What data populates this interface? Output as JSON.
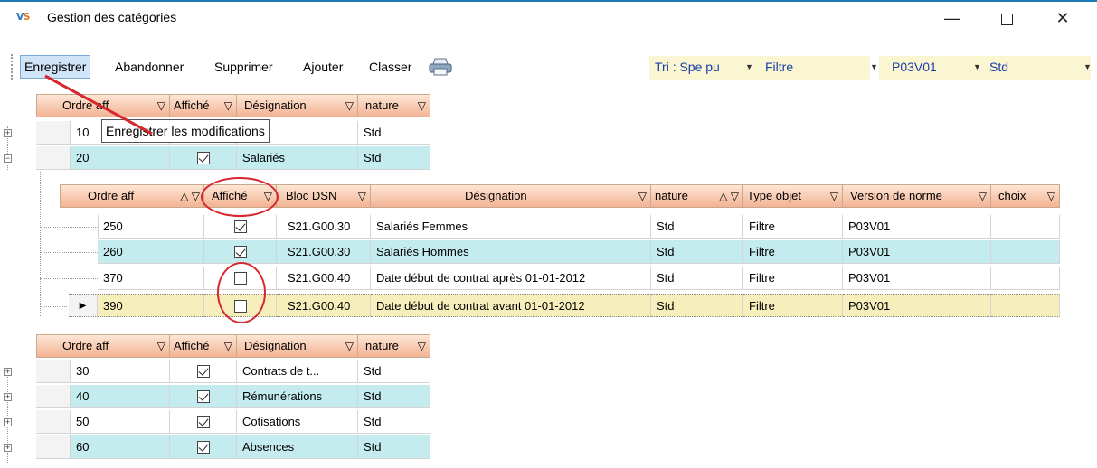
{
  "window": {
    "title": "Gestion des catégories",
    "logo": "VS",
    "min_label": "—",
    "close_label": "✕"
  },
  "toolbar": {
    "buttons": [
      "Enregistrer",
      "Abandonner",
      "Supprimer",
      "Ajouter",
      "Classer"
    ],
    "sort_value": "Tri : Spe pu",
    "filter_value": "Filtre",
    "version_value": "P03V01",
    "std_value": "Std"
  },
  "tooltip": "Enregistrer les modifications",
  "outer_headers": [
    "Ordre aff",
    "Affiché",
    "Désignation",
    "nature"
  ],
  "top_rows": [
    {
      "order": "10",
      "checked": true,
      "designation": "",
      "nature": "Std"
    },
    {
      "order": "20",
      "checked": true,
      "designation": "Salariés",
      "nature": "Std"
    }
  ],
  "inner_headers": [
    "Ordre aff",
    "Affiché",
    "Bloc DSN",
    "Désignation",
    "nature",
    "Type objet",
    "Version de norme",
    "choix"
  ],
  "inner_rows": [
    {
      "order": "250",
      "checked": true,
      "bloc": "S21.G00.30",
      "designation": "Salariés Femmes",
      "nature": "Std",
      "type": "Filtre",
      "version": "P03V01",
      "choix": ""
    },
    {
      "order": "260",
      "checked": true,
      "bloc": "S21.G00.30",
      "designation": "Salariés Hommes",
      "nature": "Std",
      "type": "Filtre",
      "version": "P03V01",
      "choix": ""
    },
    {
      "order": "370",
      "checked": false,
      "bloc": "S21.G00.40",
      "designation": "Date début de contrat après 01-01-2012",
      "nature": "Std",
      "type": "Filtre",
      "version": "P03V01",
      "choix": ""
    },
    {
      "order": "390",
      "checked": false,
      "bloc": "S21.G00.40",
      "designation": "Date début de contrat avant 01-01-2012",
      "nature": "Std",
      "type": "Filtre",
      "version": "P03V01",
      "choix": ""
    }
  ],
  "bottom_rows": [
    {
      "order": "30",
      "checked": true,
      "designation": "Contrats de t...",
      "nature": "Std"
    },
    {
      "order": "40",
      "checked": true,
      "designation": "Rémunérations",
      "nature": "Std"
    },
    {
      "order": "50",
      "checked": true,
      "designation": "Cotisations",
      "nature": "Std"
    },
    {
      "order": "60",
      "checked": true,
      "designation": "Absences",
      "nature": "Std"
    }
  ],
  "colors": {
    "header_accent": "#f3b394",
    "alt_row": "#c4ecef",
    "selected_row": "#f7efbb",
    "annotation": "#d8262e"
  },
  "icons": {
    "filter": "funnel-icon",
    "printer": "printer-icon",
    "expand": "plus-icon",
    "collapse": "minus-icon"
  }
}
